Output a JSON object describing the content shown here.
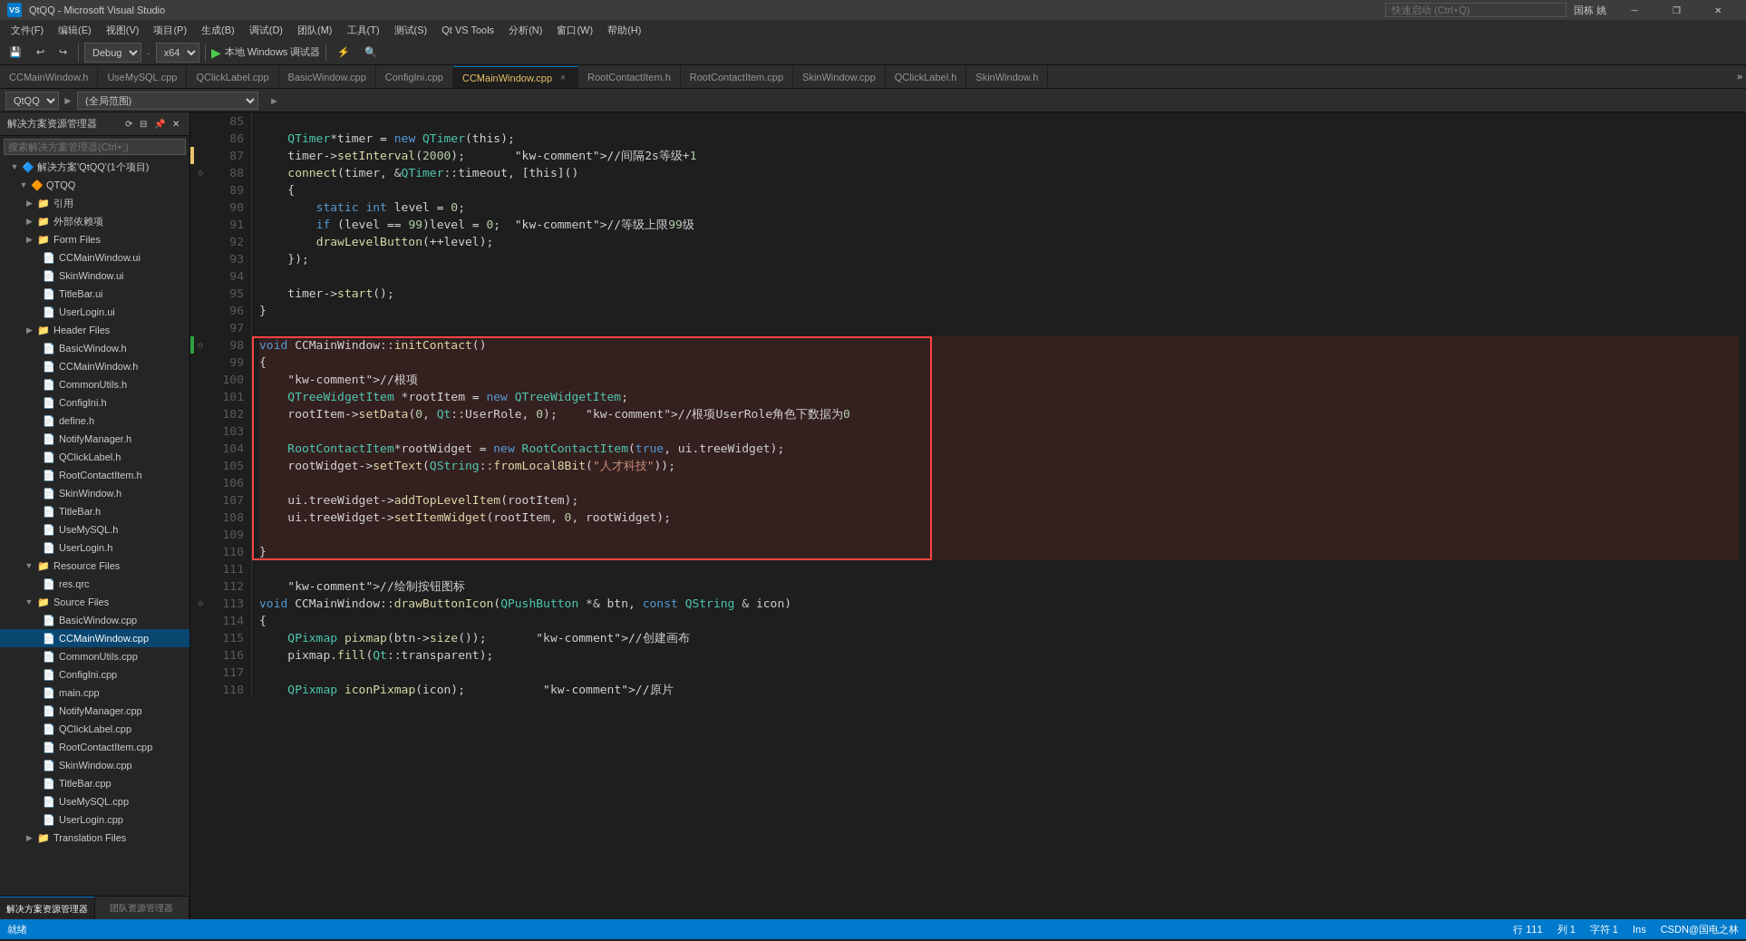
{
  "app": {
    "title": "QtQQ - Microsoft Visual Studio",
    "icon": "VS"
  },
  "title_bar": {
    "title": "QtQQ - Microsoft Visual Studio",
    "search_placeholder": "快速启动 (Ctrl+Q)",
    "username": "国栋 姚",
    "minimize": "─",
    "restore": "❐",
    "close": "✕"
  },
  "menu": {
    "items": [
      "文件(F)",
      "编辑(E)",
      "视图(V)",
      "项目(P)",
      "生成(B)",
      "调试(D)",
      "团队(M)",
      "工具(T)",
      "测试(S)",
      "Qt VS Tools",
      "分析(N)",
      "窗口(W)",
      "帮助(H)"
    ]
  },
  "toolbar": {
    "config": "Debug",
    "platform": "x64",
    "target": "本地 Windows 调试器",
    "play_label": "▶"
  },
  "tabs": [
    {
      "label": "CCMainWindow.h",
      "active": false,
      "modified": false
    },
    {
      "label": "UseMySQL.cpp",
      "active": false,
      "modified": false
    },
    {
      "label": "QClickLabel.cpp",
      "active": false,
      "modified": false
    },
    {
      "label": "BasicWindow.cpp",
      "active": false,
      "modified": false
    },
    {
      "label": "ConfigIni.cpp",
      "active": false,
      "modified": false
    },
    {
      "label": "CCMainWindow.cpp",
      "active": true,
      "modified": true
    },
    {
      "label": "RootContactItem.h",
      "active": false,
      "modified": false
    },
    {
      "label": "RootContactItem.cpp",
      "active": false,
      "modified": false
    },
    {
      "label": "SkinWindow.cpp",
      "active": false,
      "modified": false
    },
    {
      "label": "QClickLabel.h",
      "active": false,
      "modified": false
    },
    {
      "label": "SkinWindow.h",
      "active": false,
      "modified": false
    }
  ],
  "editor_subtab": {
    "scope": "QtQQ",
    "range": "(全局范围)",
    "separator": "►"
  },
  "sidebar": {
    "title": "解决方案资源管理器",
    "search_placeholder": "搜索解决方案管理器(Ctrl+;)",
    "tree": {
      "root": "解决方案'QtQQ'(1个项目)",
      "project": "QTQQ",
      "nodes": [
        {
          "label": "引用",
          "level": 2,
          "arrow": "▶",
          "icon": "📁"
        },
        {
          "label": "外部依赖项",
          "level": 2,
          "arrow": "▶",
          "icon": "📁"
        },
        {
          "label": "Form Files",
          "level": 2,
          "arrow": "▶",
          "icon": "📁"
        },
        {
          "label": "CCMainWindow.ui",
          "level": 3,
          "icon": "📄"
        },
        {
          "label": "SkinWindow.ui",
          "level": 3,
          "icon": "📄"
        },
        {
          "label": "TitleBar.ui",
          "level": 3,
          "icon": "📄"
        },
        {
          "label": "UserLogin.ui",
          "level": 3,
          "icon": "📄"
        },
        {
          "label": "Header Files",
          "level": 2,
          "arrow": "▶",
          "icon": "📁"
        },
        {
          "label": "BasicWindow.h",
          "level": 3,
          "icon": "📄"
        },
        {
          "label": "CCMainWindow.h",
          "level": 3,
          "icon": "📄"
        },
        {
          "label": "CommonUtils.h",
          "level": 3,
          "icon": "📄"
        },
        {
          "label": "ConfigIni.h",
          "level": 3,
          "icon": "📄"
        },
        {
          "label": "define.h",
          "level": 3,
          "icon": "📄"
        },
        {
          "label": "NotifyManager.h",
          "level": 3,
          "icon": "📄"
        },
        {
          "label": "QClickLabel.h",
          "level": 3,
          "icon": "📄"
        },
        {
          "label": "RootContactItem.h",
          "level": 3,
          "icon": "📄"
        },
        {
          "label": "SkinWindow.h",
          "level": 3,
          "icon": "📄"
        },
        {
          "label": "TitleBar.h",
          "level": 3,
          "icon": "📄"
        },
        {
          "label": "UseMySQL.h",
          "level": 3,
          "icon": "📄"
        },
        {
          "label": "UserLogin.h",
          "level": 3,
          "icon": "📄"
        },
        {
          "label": "Resource Files",
          "level": 2,
          "arrow": "▼",
          "icon": "📁"
        },
        {
          "label": "res.qrc",
          "level": 3,
          "icon": "📄"
        },
        {
          "label": "Source Files",
          "level": 2,
          "arrow": "▼",
          "icon": "📁"
        },
        {
          "label": "BasicWindow.cpp",
          "level": 3,
          "icon": "📄"
        },
        {
          "label": "CCMainWindow.cpp",
          "level": 3,
          "icon": "📄",
          "selected": true
        },
        {
          "label": "CommonUtils.cpp",
          "level": 3,
          "icon": "📄"
        },
        {
          "label": "ConfigIni.cpp",
          "level": 3,
          "icon": "📄"
        },
        {
          "label": "main.cpp",
          "level": 3,
          "icon": "📄"
        },
        {
          "label": "NotifyManager.cpp",
          "level": 3,
          "icon": "📄"
        },
        {
          "label": "QClickLabel.cpp",
          "level": 3,
          "icon": "📄"
        },
        {
          "label": "RootContactItem.cpp",
          "level": 3,
          "icon": "📄"
        },
        {
          "label": "SkinWindow.cpp",
          "level": 3,
          "icon": "📄"
        },
        {
          "label": "TitleBar.cpp",
          "level": 3,
          "icon": "📄"
        },
        {
          "label": "UseMySQL.cpp",
          "level": 3,
          "icon": "📄"
        },
        {
          "label": "UserLogin.cpp",
          "level": 3,
          "icon": "📄"
        },
        {
          "label": "Translation Files",
          "level": 2,
          "arrow": "▶",
          "icon": "📁"
        }
      ]
    },
    "bottom_tabs": [
      {
        "label": "解决方案资源管理器",
        "active": true
      },
      {
        "label": "团队资源管理器",
        "active": false
      }
    ]
  },
  "code": {
    "lines": [
      {
        "num": 85,
        "content": "",
        "fold": "",
        "change": ""
      },
      {
        "num": 86,
        "content": "    QTimer*timer = new QTimer(this);",
        "fold": "",
        "change": ""
      },
      {
        "num": 87,
        "content": "    timer->setInterval(2000);       //间隔2s等级+1",
        "fold": "",
        "change": "yellow"
      },
      {
        "num": 88,
        "content": "    connect(timer, &QTimer::timeout, [this]()",
        "fold": "⊖",
        "change": ""
      },
      {
        "num": 89,
        "content": "    {",
        "fold": "",
        "change": ""
      },
      {
        "num": 90,
        "content": "        static int level = 0;",
        "fold": "",
        "change": ""
      },
      {
        "num": 91,
        "content": "        if (level == 99)level = 0;  //等级上限99级",
        "fold": "",
        "change": ""
      },
      {
        "num": 92,
        "content": "        drawLevelButton(++level);",
        "fold": "",
        "change": ""
      },
      {
        "num": 93,
        "content": "    });",
        "fold": "",
        "change": ""
      },
      {
        "num": 94,
        "content": "",
        "fold": "",
        "change": ""
      },
      {
        "num": 95,
        "content": "    timer->start();",
        "fold": "",
        "change": ""
      },
      {
        "num": 96,
        "content": "}",
        "fold": "",
        "change": ""
      },
      {
        "num": 97,
        "content": "",
        "fold": "",
        "change": ""
      },
      {
        "num": 98,
        "content": "void CCMainWindow::initContact()",
        "fold": "⊖",
        "change": "green",
        "highlight": true
      },
      {
        "num": 99,
        "content": "{",
        "fold": "",
        "change": "",
        "highlight": true
      },
      {
        "num": 100,
        "content": "    //根项",
        "fold": "",
        "change": "",
        "highlight": true
      },
      {
        "num": 101,
        "content": "    QTreeWidgetItem *rootItem = new QTreeWidgetItem;",
        "fold": "",
        "change": "",
        "highlight": true
      },
      {
        "num": 102,
        "content": "    rootItem->setData(0, Qt::UserRole, 0);    //根项UserRole角色下数据为0",
        "fold": "",
        "change": "",
        "highlight": true
      },
      {
        "num": 103,
        "content": "",
        "fold": "",
        "change": "",
        "highlight": true
      },
      {
        "num": 104,
        "content": "    RootContactItem*rootWidget = new RootContactItem(true, ui.treeWidget);",
        "fold": "",
        "change": "",
        "highlight": true
      },
      {
        "num": 105,
        "content": "    rootWidget->setText(QString::fromLocal8Bit(\"人才科技\"));",
        "fold": "",
        "change": "",
        "highlight": true
      },
      {
        "num": 106,
        "content": "",
        "fold": "",
        "change": "",
        "highlight": true
      },
      {
        "num": 107,
        "content": "    ui.treeWidget->addTopLevelItem(rootItem);",
        "fold": "",
        "change": "",
        "highlight": true
      },
      {
        "num": 108,
        "content": "    ui.treeWidget->setItemWidget(rootItem, 0, rootWidget);",
        "fold": "",
        "change": "",
        "highlight": true
      },
      {
        "num": 109,
        "content": "",
        "fold": "",
        "change": "",
        "highlight": true
      },
      {
        "num": 110,
        "content": "}",
        "fold": "",
        "change": "",
        "highlight": true
      },
      {
        "num": 111,
        "content": "",
        "fold": "",
        "change": ""
      },
      {
        "num": 112,
        "content": "    //绘制按钮图标",
        "fold": "",
        "change": ""
      },
      {
        "num": 113,
        "content": "void CCMainWindow::drawButtonIcon(QPushButton *& btn, const QString & icon)",
        "fold": "⊖",
        "change": ""
      },
      {
        "num": 114,
        "content": "{",
        "fold": "",
        "change": ""
      },
      {
        "num": 115,
        "content": "    QPixmap pixmap(btn->size());       //创建画布",
        "fold": "",
        "change": ""
      },
      {
        "num": 116,
        "content": "    pixmap.fill(Qt::transparent);",
        "fold": "",
        "change": ""
      },
      {
        "num": 117,
        "content": "",
        "fold": "",
        "change": ""
      },
      {
        "num": 118,
        "content": "    QPixmap iconPixmap(icon);           //原片",
        "fold": "",
        "change": ""
      }
    ]
  },
  "status_bar": {
    "left": "就绪",
    "line": "行 111",
    "col": "列 1",
    "char": "字符 1",
    "ins": "Ins",
    "watermark": "CSDN@国电之林"
  },
  "colors": {
    "accent": "#007acc",
    "background": "#1e1e1e",
    "sidebar_bg": "#252526",
    "tab_bar_bg": "#2d2d2d",
    "active_tab_bg": "#1e1e1e",
    "highlight_box": "#ff4444"
  }
}
